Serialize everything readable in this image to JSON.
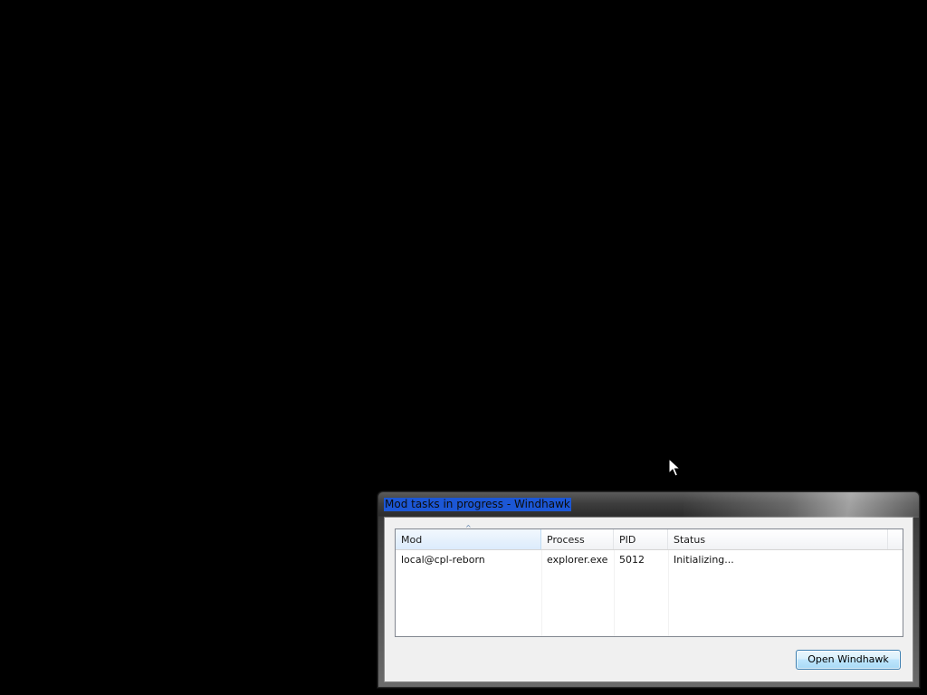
{
  "window": {
    "title": "Mod tasks in progress - Windhawk"
  },
  "listview": {
    "columns": [
      {
        "label": "Mod",
        "sorted": "ascending"
      },
      {
        "label": "Process"
      },
      {
        "label": "PID"
      },
      {
        "label": "Status"
      }
    ],
    "rows": [
      {
        "mod": "local@cpl-reborn",
        "process": "explorer.exe",
        "pid": "5012",
        "status": "Initializing..."
      }
    ]
  },
  "buttons": {
    "open_windhawk": "Open Windhawk"
  },
  "colors": {
    "desktop": "#000000",
    "title_selection": "#1c57d6",
    "button_border": "#3c7fb1"
  },
  "icons": {
    "cursor": "arrow-cursor-icon",
    "sort": "sort-ascending-icon"
  }
}
